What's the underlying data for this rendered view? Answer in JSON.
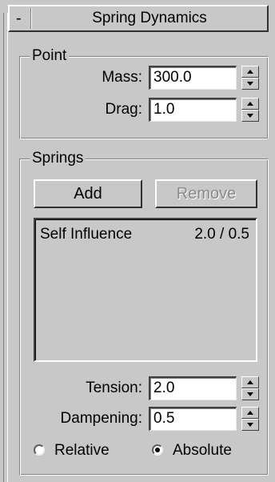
{
  "rollout": {
    "collapse_symbol": "-",
    "title": "Spring Dynamics"
  },
  "point": {
    "label": "Point",
    "mass": {
      "label": "Mass:",
      "value": "300.0"
    },
    "drag": {
      "label": "Drag:",
      "value": "1.0"
    }
  },
  "springs": {
    "label": "Springs",
    "add_label": "Add",
    "remove_label": "Remove",
    "remove_enabled": false,
    "list": [
      {
        "name": "Self Influence",
        "value": "2.0 / 0.5"
      }
    ],
    "tension": {
      "label": "Tension:",
      "value": "2.0"
    },
    "dampening": {
      "label": "Dampening:",
      "value": "0.5"
    },
    "mode": {
      "options": [
        "Relative",
        "Absolute"
      ],
      "selected": "Absolute"
    }
  },
  "icons": {
    "spinner_up": "triangle-up-icon",
    "spinner_down": "triangle-down-icon"
  }
}
